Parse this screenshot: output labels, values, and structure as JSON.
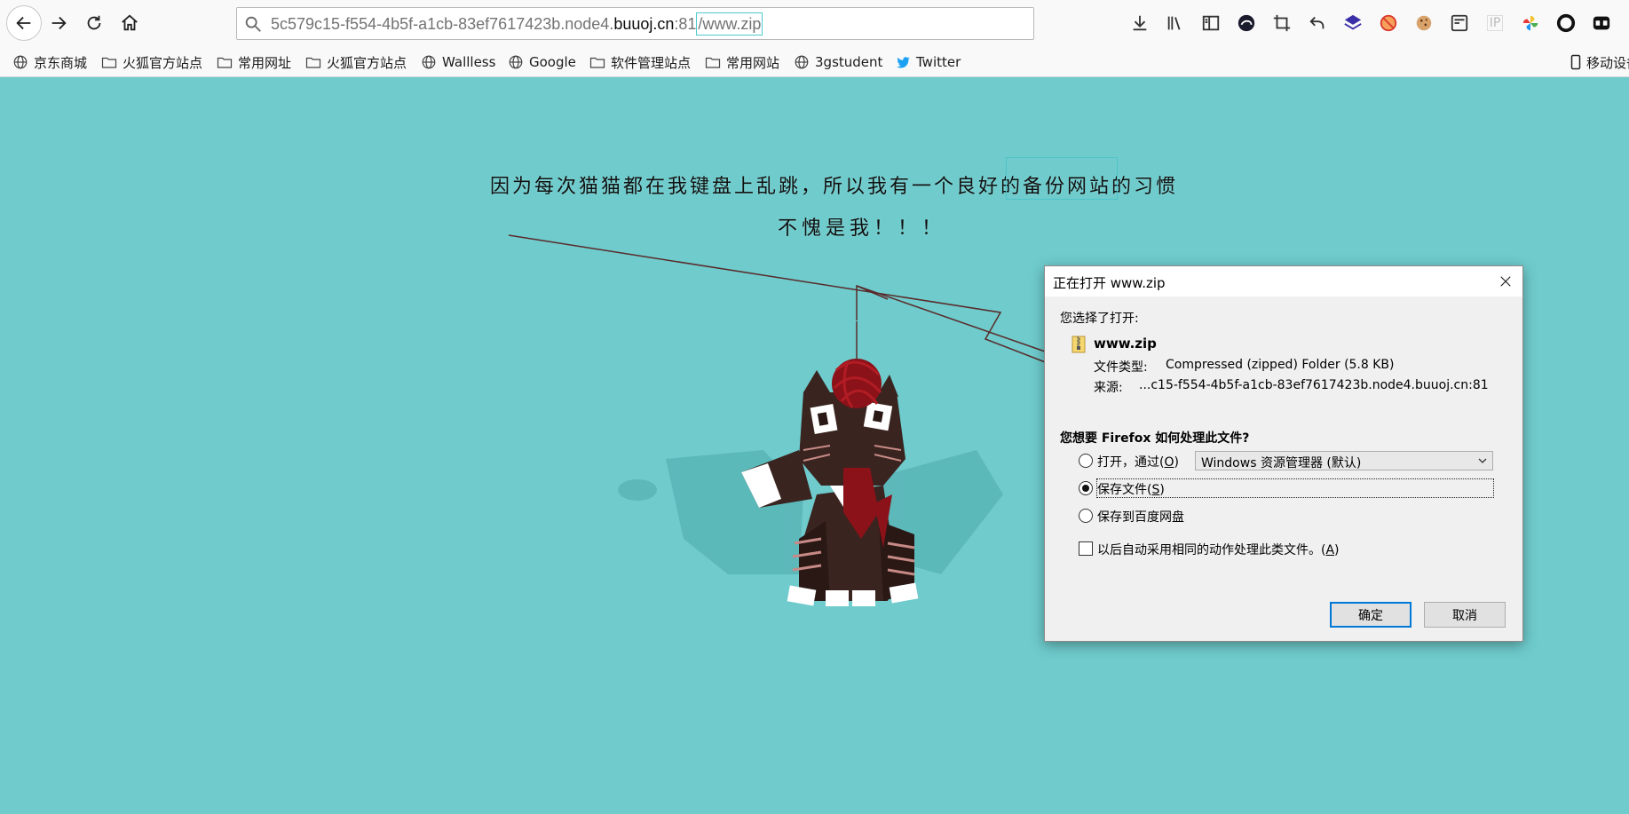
{
  "browser": {
    "url_host_prefix": "5c579c15-f554-4b5f-a1cb-83ef7617423b.node4.",
    "url_host_domain": "buuoj.cn",
    "url_port": ":81",
    "url_path": "/www.zip",
    "toolbar_icons": [
      "download-icon",
      "library-icon",
      "sidebar-icon",
      "edge-icon",
      "crop-icon",
      "undo-icon",
      "layers-icon",
      "block-icon",
      "cookie-icon",
      "reader-icon",
      "ip-icon",
      "pinwheel-icon",
      "circle-icon",
      "gamepad-icon"
    ],
    "ip_label": "IP"
  },
  "bookmarks": [
    {
      "label": "京东商城",
      "icon": "globe-icon"
    },
    {
      "label": "火狐官方站点",
      "icon": "folder-icon"
    },
    {
      "label": "常用网址",
      "icon": "folder-icon"
    },
    {
      "label": "火狐官方站点",
      "icon": "folder-icon"
    },
    {
      "label": "Wallless",
      "icon": "globe-icon"
    },
    {
      "label": "Google",
      "icon": "globe-icon"
    },
    {
      "label": "软件管理站点",
      "icon": "folder-icon"
    },
    {
      "label": "常用网站",
      "icon": "folder-icon"
    },
    {
      "label": "3gstudent",
      "icon": "globe-icon"
    },
    {
      "label": "Twitter",
      "icon": "twitter-icon"
    }
  ],
  "bookmarks_overflow": "移动设备",
  "page": {
    "caption_line1": "因为每次猫猫都在我键盘上乱跳，所以我有一个良好的备份网站的习惯",
    "caption_line2": "不愧是我！！！",
    "background_color": "#6fcbcc"
  },
  "dialog": {
    "title": "正在打开 www.zip",
    "chosen_label": "您选择了打开:",
    "file_name": "www.zip",
    "type_label": "文件类型:",
    "type_value": "Compressed (zipped) Folder (5.8 KB)",
    "source_label": "来源:",
    "source_value": "...c15-f554-4b5f-a1cb-83ef7617423b.node4.buuoj.cn:81",
    "question": "您想要 Firefox 如何处理此文件?",
    "open_with_label": "打开，通过(",
    "open_with_key": "O",
    "open_with_app": "Windows 资源管理器 (默认)",
    "save_file_label": "保存文件(",
    "save_file_key": "S",
    "save_baidu_label": "保存到百度网盘",
    "remember_label": "以后自动采用相同的动作处理此类文件。(",
    "remember_key": "A",
    "ok_label": "确定",
    "cancel_label": "取消",
    "selected_option": "save_file",
    "remember_checked": false
  }
}
